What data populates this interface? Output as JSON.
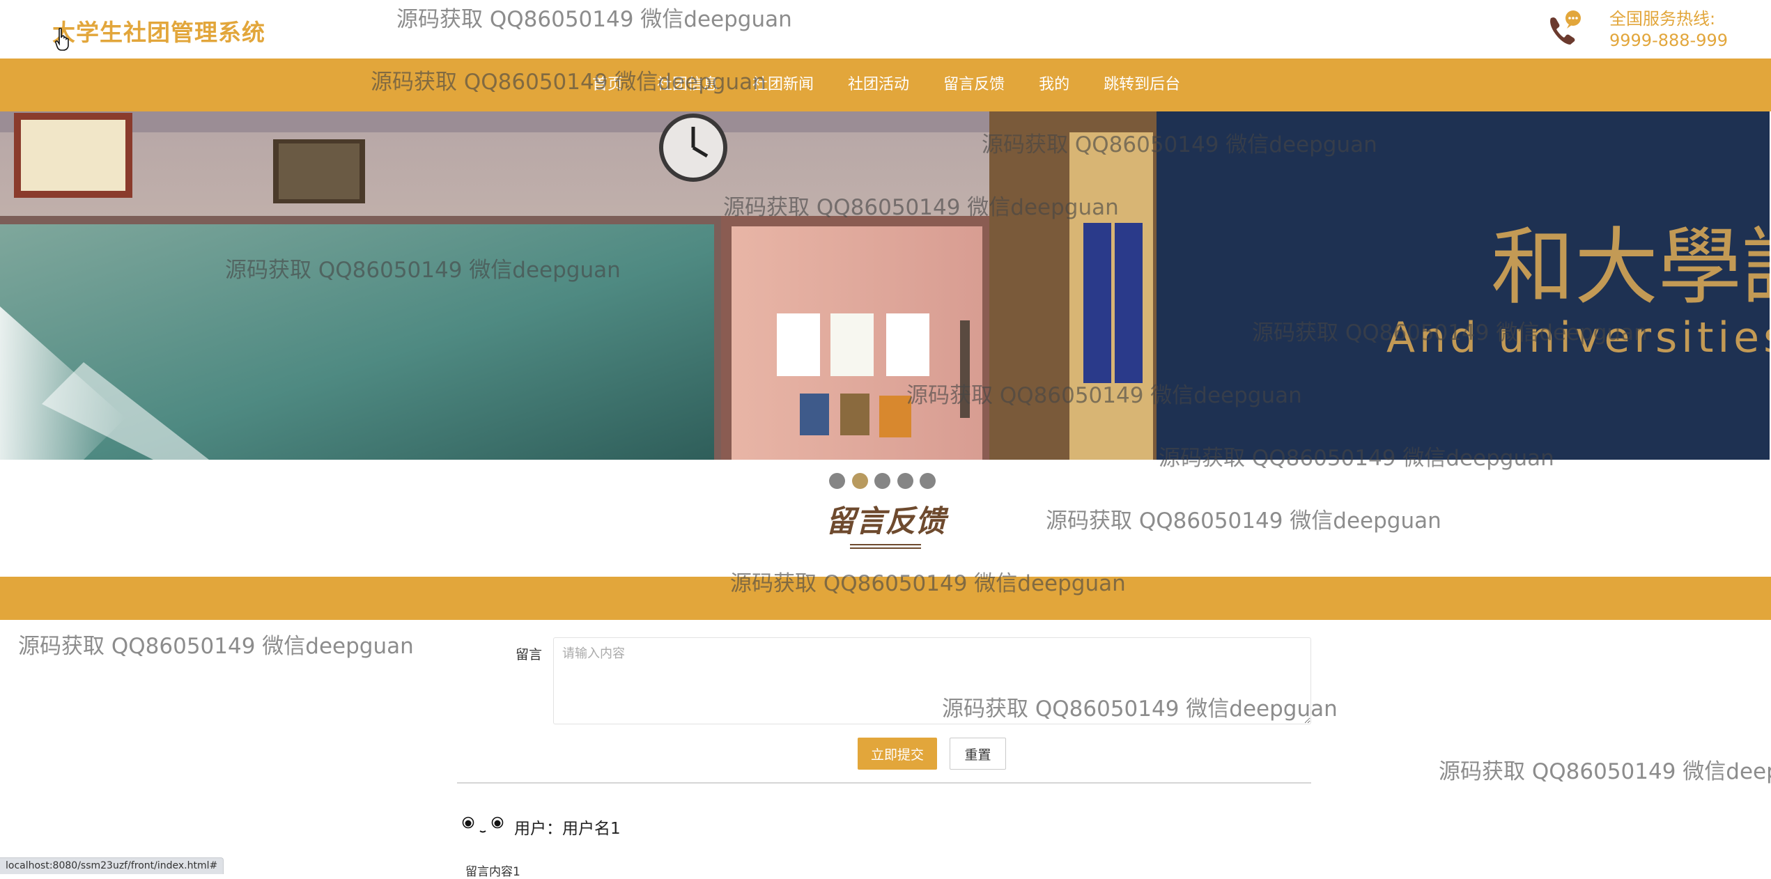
{
  "header": {
    "logo": "大学生社团管理系统",
    "hotline_label": "全国服务热线:",
    "hotline_number": "9999-888-999"
  },
  "nav": {
    "items": [
      "首页",
      "社团信息",
      "社团新闻",
      "社团活动",
      "留言反馈",
      "我的",
      "跳转到后台"
    ]
  },
  "banner": {
    "sign_text": "和大學說",
    "sign_subtext": "And universities to",
    "active_slide": 2,
    "slide_count": 5
  },
  "section": {
    "title": "留言反馈"
  },
  "form": {
    "label": "留言",
    "placeholder": "请输入内容",
    "value": "",
    "submit_label": "立即提交",
    "reset_label": "重置"
  },
  "comments": [
    {
      "user_line": "用户：用户名1",
      "content": "留言内容1"
    }
  ],
  "status_url": "localhost:8080/ssm23uzf/front/index.html#",
  "watermark": "源码获取 QQ86050149 微信deepguan",
  "colors": {
    "accent": "#e2a63b",
    "title_brown": "#6e4a2e",
    "dot_active": "#b89a5f",
    "dot_inactive": "#858585"
  }
}
